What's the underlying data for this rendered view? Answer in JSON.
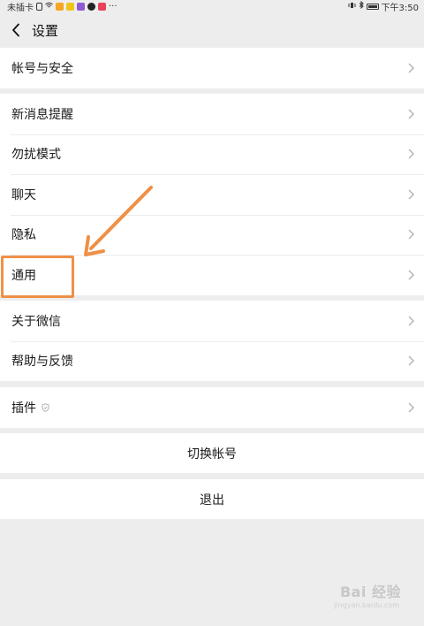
{
  "status_bar": {
    "carrier": "未插卡",
    "time": "下午3:50"
  },
  "nav": {
    "title": "设置"
  },
  "groups": {
    "account": {
      "items": [
        {
          "label": "帐号与安全"
        }
      ]
    },
    "prefs": {
      "items": [
        {
          "label": "新消息提醒"
        },
        {
          "label": "勿扰模式"
        },
        {
          "label": "聊天"
        },
        {
          "label": "隐私"
        },
        {
          "label": "通用"
        }
      ]
    },
    "about": {
      "items": [
        {
          "label": "关于微信"
        },
        {
          "label": "帮助与反馈"
        }
      ]
    },
    "plugins": {
      "items": [
        {
          "label": "插件"
        }
      ]
    }
  },
  "actions": {
    "switch_account": "切换帐号",
    "logout": "退出"
  },
  "watermark": {
    "brand": "Bai 经验",
    "url": "jingyan.baidu.com"
  },
  "colors": {
    "highlight": "#ef9047",
    "background": "#ededed"
  }
}
